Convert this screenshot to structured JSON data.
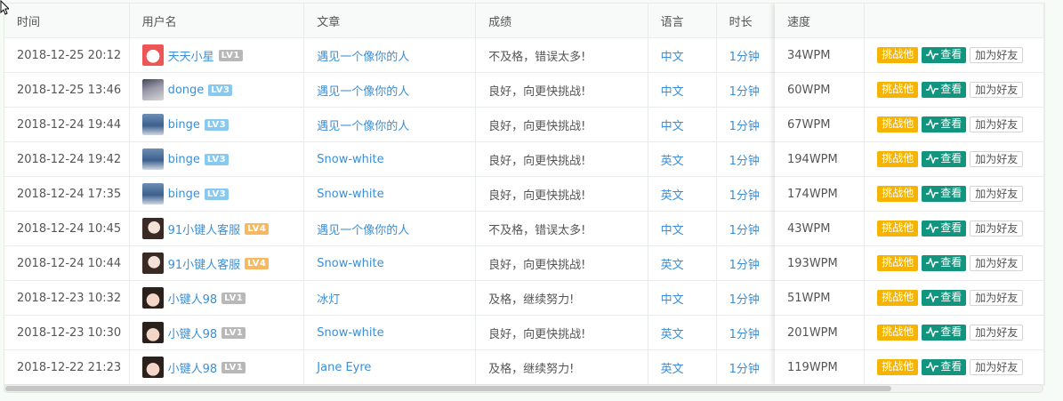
{
  "headers": {
    "time": "时间",
    "user": "用户名",
    "article": "文章",
    "grade": "成绩",
    "language": "语言",
    "duration": "时长",
    "speed": "速度"
  },
  "buttons": {
    "challenge": "挑战他",
    "view": "查看",
    "add_friend": "加为好友"
  },
  "rows": [
    {
      "time": "2018-12-25 20:12",
      "user": "天天小星",
      "level": "LV1",
      "article": "遇见一个像你的人",
      "grade": "不及格，错误太多!",
      "language": "中文",
      "duration": "1分钟",
      "speed": "34WPM"
    },
    {
      "time": "2018-12-25 13:46",
      "user": "donge",
      "level": "LV3",
      "article": "遇见一个像你的人",
      "grade": "良好，向更快挑战!",
      "language": "中文",
      "duration": "1分钟",
      "speed": "60WPM"
    },
    {
      "time": "2018-12-24 19:44",
      "user": "binge",
      "level": "LV3",
      "article": "遇见一个像你的人",
      "grade": "良好，向更快挑战!",
      "language": "中文",
      "duration": "1分钟",
      "speed": "67WPM"
    },
    {
      "time": "2018-12-24 19:42",
      "user": "binge",
      "level": "LV3",
      "article": "Snow-white",
      "grade": "良好，向更快挑战!",
      "language": "英文",
      "duration": "1分钟",
      "speed": "194WPM"
    },
    {
      "time": "2018-12-24 17:35",
      "user": "binge",
      "level": "LV3",
      "article": "Snow-white",
      "grade": "良好，向更快挑战!",
      "language": "英文",
      "duration": "1分钟",
      "speed": "174WPM"
    },
    {
      "time": "2018-12-24 10:45",
      "user": "91小键人客服",
      "level": "LV4",
      "article": "遇见一个像你的人",
      "grade": "不及格，错误太多!",
      "language": "中文",
      "duration": "1分钟",
      "speed": "43WPM"
    },
    {
      "time": "2018-12-24 10:44",
      "user": "91小键人客服",
      "level": "LV4",
      "article": "Snow-white",
      "grade": "良好，向更快挑战!",
      "language": "英文",
      "duration": "1分钟",
      "speed": "193WPM"
    },
    {
      "time": "2018-12-23 10:32",
      "user": "小键人98",
      "level": "LV1",
      "article": "冰灯",
      "grade": "及格，继续努力!",
      "language": "中文",
      "duration": "1分钟",
      "speed": "51WPM"
    },
    {
      "time": "2018-12-23 10:30",
      "user": "小键人98",
      "level": "LV1",
      "article": "Snow-white",
      "grade": "良好，向更快挑战!",
      "language": "英文",
      "duration": "1分钟",
      "speed": "201WPM"
    },
    {
      "time": "2018-12-22 21:23",
      "user": "小键人98",
      "level": "LV1",
      "article": "Jane Eyre",
      "grade": "及格，继续努力!",
      "language": "英文",
      "duration": "1分钟",
      "speed": "119WPM"
    }
  ],
  "colors": {
    "link": "#3a8fd8",
    "challenge": "#f6b400",
    "view": "#11957e"
  }
}
